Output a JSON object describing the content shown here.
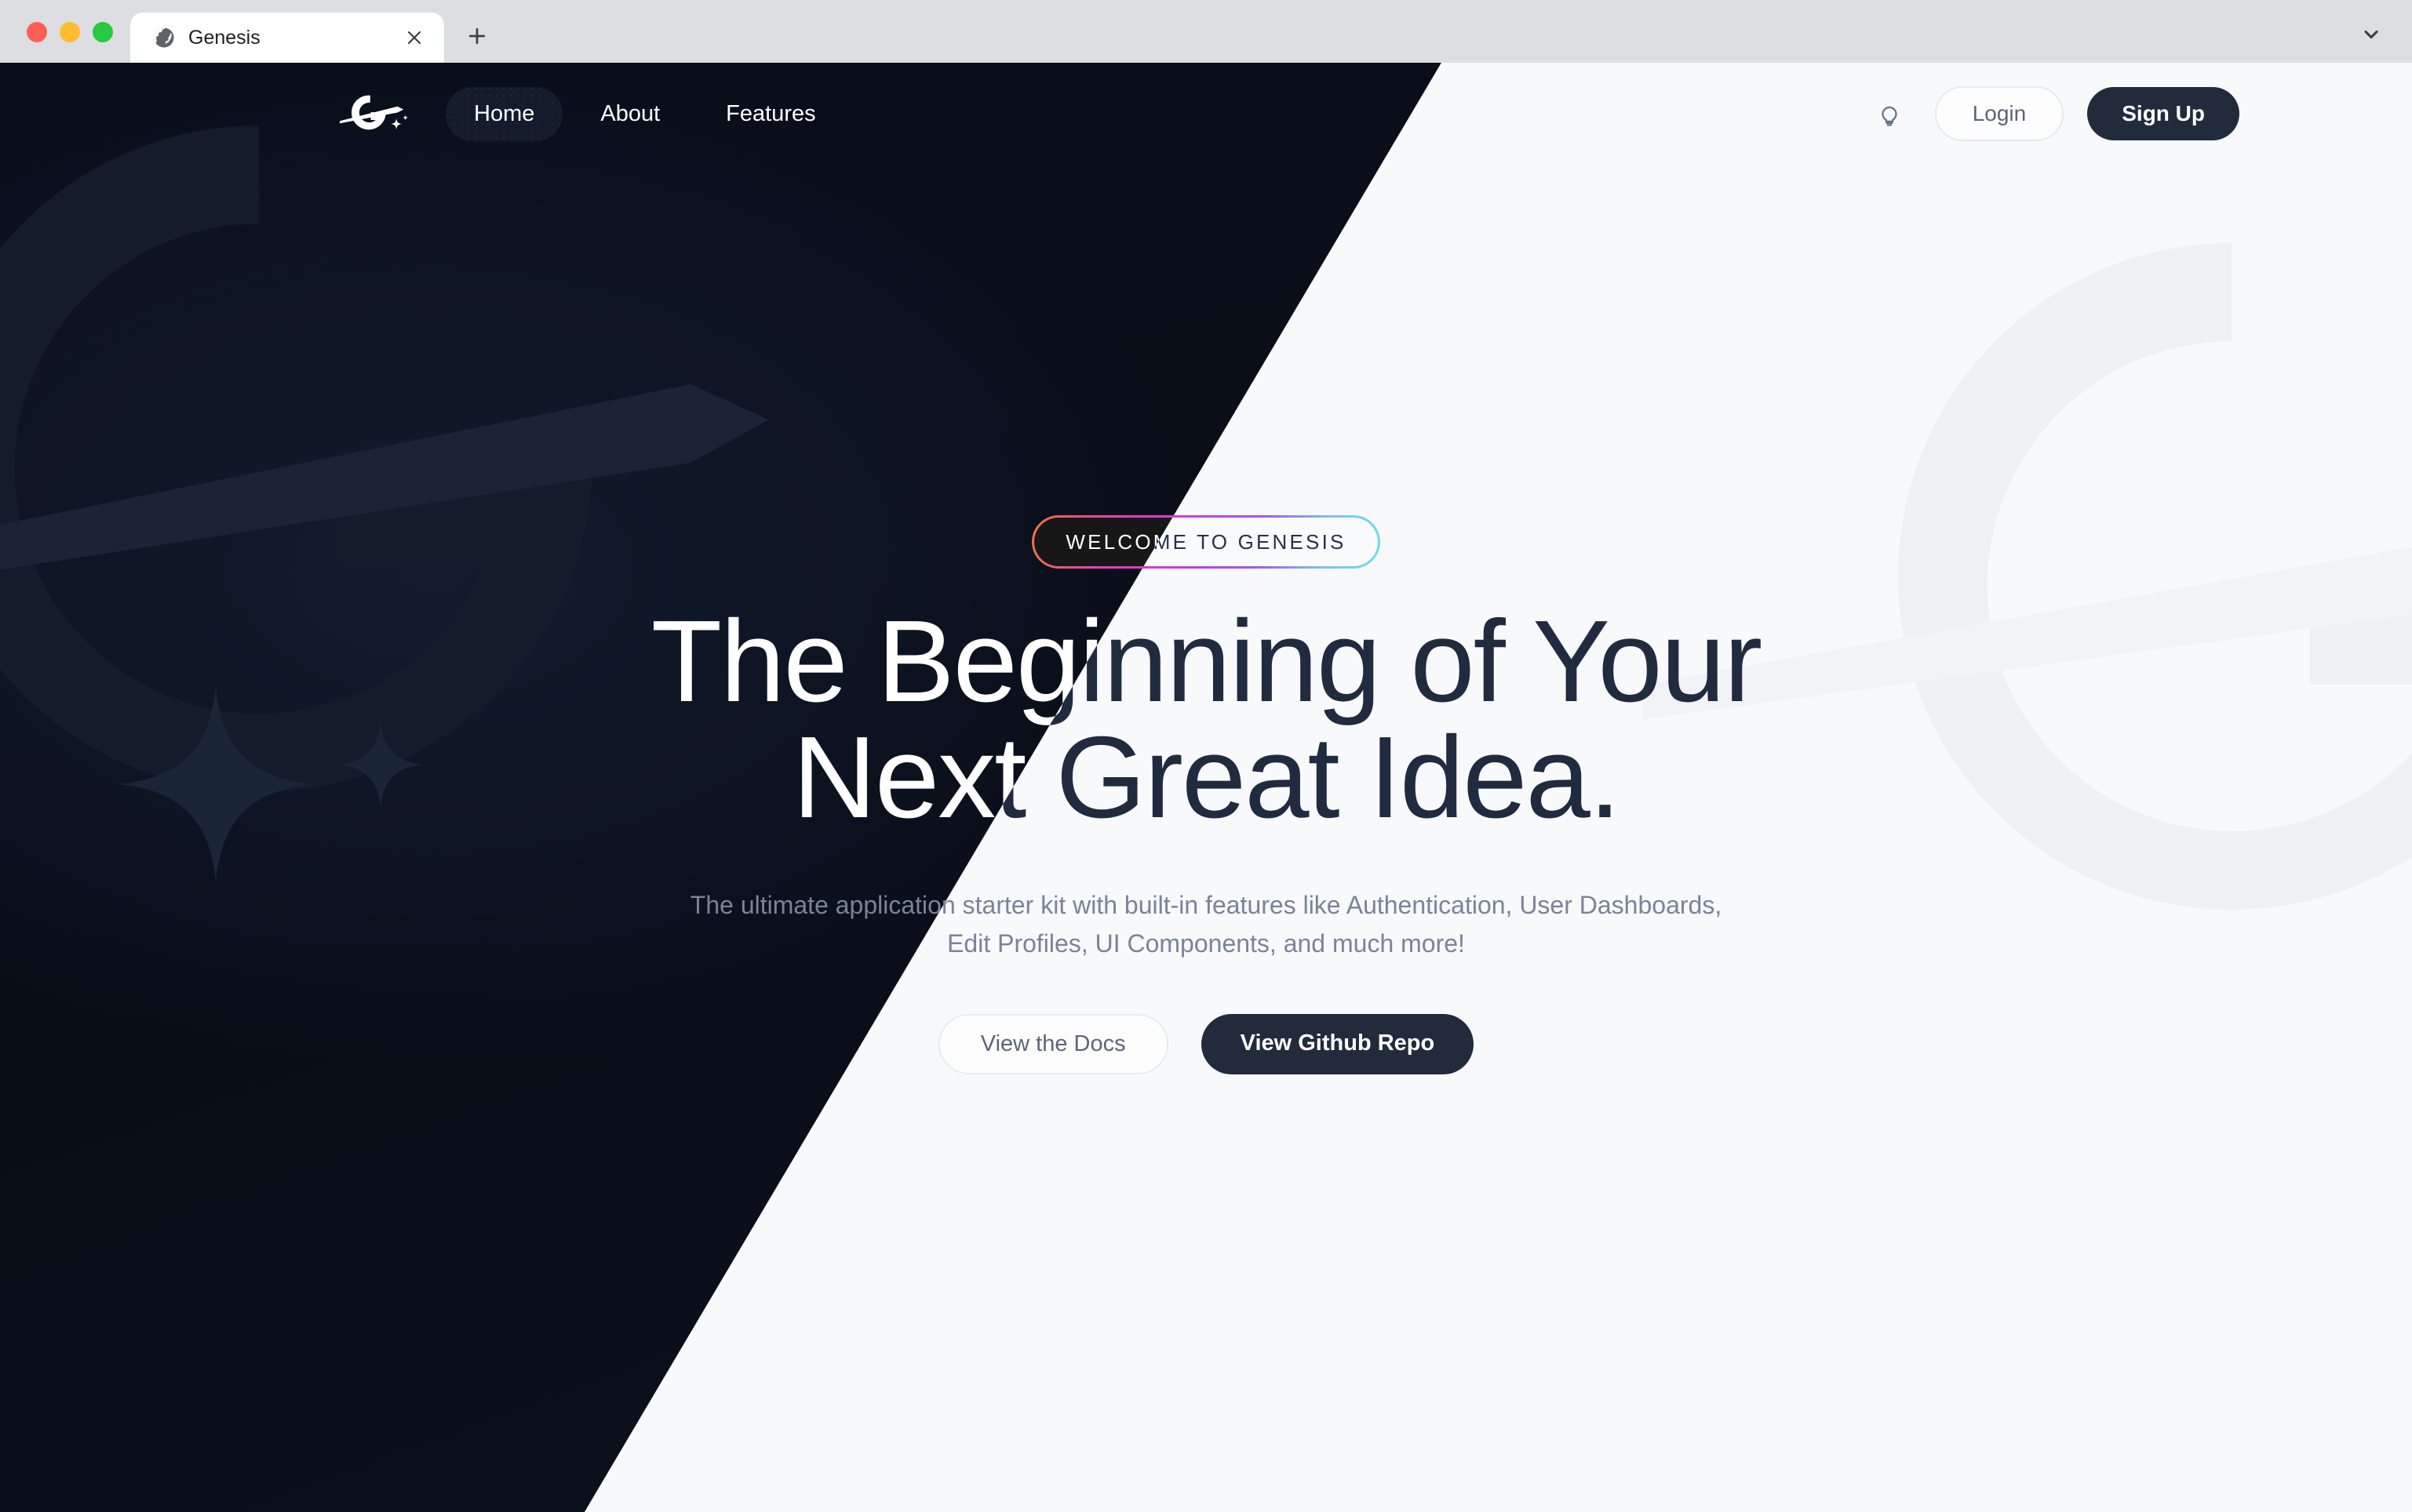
{
  "browser": {
    "tab": {
      "title": "Genesis",
      "favicon_icon": "globe-icon",
      "close_icon": "close-icon"
    },
    "new_tab_icon": "plus-icon",
    "tab_list_icon": "chevron-down-icon",
    "traffic_lights": [
      "close-red",
      "minimize-yellow",
      "maximize-green"
    ]
  },
  "nav": {
    "logo_icon": "genesis-orbit-logo",
    "links": [
      {
        "label": "Home",
        "active": true
      },
      {
        "label": "About",
        "active": false
      },
      {
        "label": "Features",
        "active": false
      }
    ],
    "theme_toggle_icon": "lightbulb-icon",
    "login_label": "Login",
    "signup_label": "Sign Up"
  },
  "hero": {
    "badge": "WELCOME TO GENESIS",
    "title_line1": "The Beginning of Your",
    "title_line2": "Next Great Idea.",
    "subtitle": "The ultimate application starter kit with built-in features like Authentication, User Dashboards, Edit Profiles, UI Components, and much more!",
    "cta_primary": "View Github Repo",
    "cta_secondary": "View the Docs"
  },
  "colors": {
    "dark_bg": "#0a0f1c",
    "light_bg": "#f7f9fb",
    "dark_text": "#212b3f",
    "muted_text": "#79839a",
    "button_dark": "#212b3b",
    "badge_gradient_start": "#f4783b",
    "badge_gradient_mid": "#c13fe8",
    "badge_gradient_end": "#63e0e8",
    "chrome_bg": "#dcdee1"
  }
}
